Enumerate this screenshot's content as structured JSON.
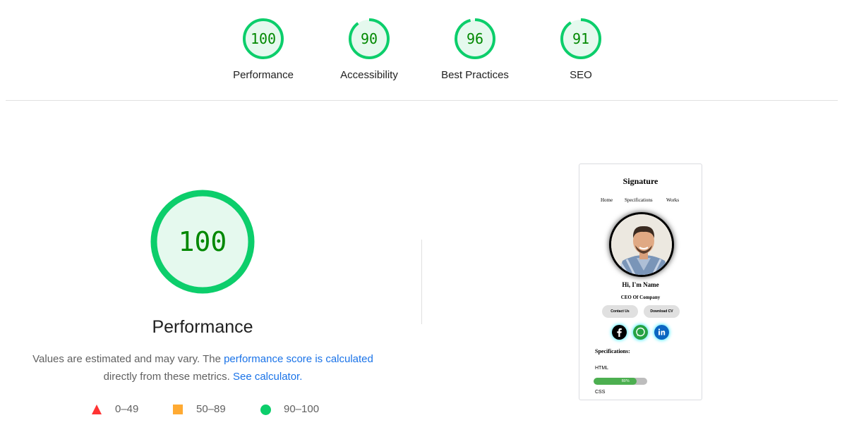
{
  "categories": [
    {
      "label": "Performance",
      "score": "100",
      "value": 100
    },
    {
      "label": "Accessibility",
      "score": "90",
      "value": 90
    },
    {
      "label": "Best Practices",
      "score": "96",
      "value": 96
    },
    {
      "label": "SEO",
      "score": "91",
      "value": 91
    }
  ],
  "main": {
    "score": "100",
    "title": "Performance",
    "desc_part1": "Values are estimated and may vary. The ",
    "desc_link": "performance score is calculated",
    "desc_part2": "directly from these metrics. ",
    "desc_calc_link": "See calculator."
  },
  "legend": {
    "fail": "0–49",
    "average": "50–89",
    "pass": "90–100"
  },
  "colors": {
    "pass": "#0cce6b",
    "pass_text": "#008800",
    "pass_bg": "#e5f9ee",
    "average": "#ffaa33",
    "fail": "#ff3333",
    "link": "#1a73e8"
  },
  "screenshot": {
    "title": "Signature",
    "nav": [
      "Home",
      "Specifications",
      "Works"
    ],
    "name": "Hi, I'm Name",
    "role": "CEO Of Company",
    "btn_contact": "Contact Us",
    "btn_cv": "Download CV",
    "social_icons": [
      "facebook-icon",
      "whatsapp-icon",
      "linkedin-icon"
    ],
    "specs_title": "Specifications:",
    "skill1": "HTML",
    "skill1_pct": "80%",
    "skill1_value": 0.8,
    "skill2": "CSS"
  }
}
